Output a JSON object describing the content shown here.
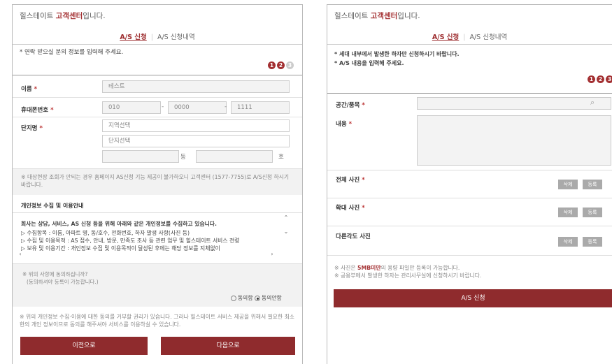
{
  "left": {
    "title_prefix": "힐스테이트 ",
    "title_highlight": "고객센터",
    "title_suffix": "입니다.",
    "tab_active": "A/S 신청",
    "tab_other": "A/S 신청내역",
    "notice": "* 연락 받으실 분의 정보를 입력해 주세요.",
    "steps": [
      "1",
      "2",
      "3"
    ],
    "name_label": "이름",
    "name_value": "테스트",
    "phone_label": "휴대폰번호",
    "phone_1": "010",
    "phone_2": "0000",
    "phone_3": "1111",
    "complex_label": "단지명",
    "region_select": "지역선택",
    "complex_select": "단지선택",
    "dong_unit": "동",
    "ho_unit": "호",
    "req_mark": "*",
    "dash": "-",
    "inquiry_note": "※ 대상현장 조회가 안되는 경우 홈페이지 AS신청 기능 제공이 불가하오니 고객센터 (1577-7755)로 A/S신청 하시기 바랍니다.",
    "privacy_title": "개인정보 수집 및 이용안내",
    "privacy_lines": [
      "회사는 상담, 서비스, AS 신청 등을 위해 아래와 같은 개인정보를 수집하고 있습니다.",
      "▷ 수집항목 : 이름, 아파트 명, 동/호수, 전화번호, 하자 발생 사항(사진 등)",
      "▷ 수집 및 이용목적 : AS 접수, 안내, 방문, 만족도 조사 등 관련 업무 및 힐스테이트 서비스 전령",
      "▷ 보유 및 이용기간 : 개인정보 수집 및 이용목적이 달성된 후에는 해당 정보를 지체없이"
    ],
    "agree_question": "※ 위의 사항에 동의하십니까?",
    "agree_question2": "(동의하셔야 등록이 가능합니다.)",
    "agree_yes": "동의함",
    "agree_no": "동의안함",
    "footer_note": "※ 위의 개인정보 수집·이용에 대한 동의를 거부할 권리가 있습니다. 그러나 힐스테이트 서비스 제공을 위해서 필요한 최소한의 개인 정보이므로 동의를 해주셔야 서비스를 이용하실 수 있습니다.",
    "prev_button": "이전으로",
    "next_button": "다음으로",
    "scroll_up": "⌃",
    "scroll_down": "⌄",
    "scroll_left": "‹",
    "scroll_right": "›"
  },
  "right": {
    "title_prefix": "힐스테이트 ",
    "title_highlight": "고객센터",
    "title_suffix": "입니다.",
    "tab_active": "A/S 신청",
    "tab_other": "A/S 신청내역",
    "notice_1": "* 세대 내부에서 발생한 하자만 신청하시기 바랍니다.",
    "notice_2": "* A/S 내용을 입력해 주세요.",
    "steps": [
      "1",
      "2",
      "3"
    ],
    "space_label": "공간/품목",
    "content_label": "내용",
    "req_mark": "*",
    "photo_full_label": "전체 사진",
    "photo_zoom_label": "확대 사진",
    "photo_other_label": "다른각도 사진",
    "delete_label": "삭제",
    "register_label": "등록",
    "note_1_prefix": "※ 사진은 ",
    "note_1_highlight": "5MB미만",
    "note_1_suffix": "의 용량 파일만 등록이 가능합니다.",
    "note_2": "※ 공용부에서 발생한 하자는 관리사무실에 신청하시기 바랍니다.",
    "submit_button": "A/S 신청",
    "search_icon": "⌕"
  },
  "colors": {
    "accent": "#8f2b2d",
    "highlight": "#a33032"
  }
}
